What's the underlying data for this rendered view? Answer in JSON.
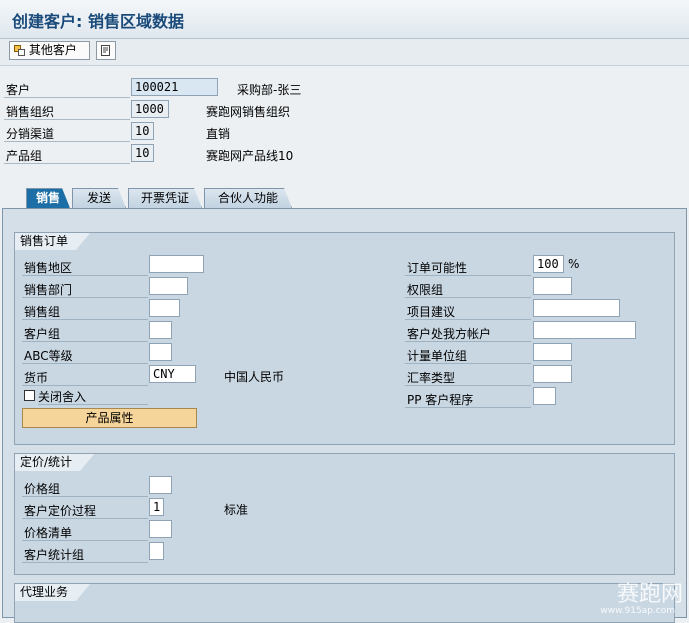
{
  "window": {
    "title": "创建客户: 销售区域数据"
  },
  "toolbar": {
    "other_customer_label": "其他客户"
  },
  "header": {
    "customer": {
      "label": "客户",
      "value": "100021",
      "desc": "采购部-张三"
    },
    "sales_org": {
      "label": "销售组织",
      "value": "1000",
      "desc": "赛跑网销售组织"
    },
    "dist_channel": {
      "label": "分销渠道",
      "value": "10",
      "desc": "直销"
    },
    "division": {
      "label": "产品组",
      "value": "10",
      "desc": "赛跑网产品线10"
    }
  },
  "tabs": [
    {
      "label": "销售",
      "active": true
    },
    {
      "label": "发送",
      "active": false
    },
    {
      "label": "开票凭证",
      "active": false
    },
    {
      "label": "合伙人功能",
      "active": false
    }
  ],
  "sales_order": {
    "title": "销售订单",
    "left": [
      {
        "label": "销售地区",
        "value": ""
      },
      {
        "label": "销售部门",
        "value": ""
      },
      {
        "label": "销售组",
        "value": ""
      },
      {
        "label": "客户组",
        "value": ""
      },
      {
        "label": "ABC等级",
        "value": ""
      },
      {
        "label": "货币",
        "value": "CNY",
        "desc": "中国人民币"
      }
    ],
    "right": [
      {
        "label": "订单可能性",
        "value": "100",
        "unit": "%"
      },
      {
        "label": "权限组",
        "value": ""
      },
      {
        "label": "项目建议",
        "value": ""
      },
      {
        "label": "客户处我方帐户",
        "value": ""
      },
      {
        "label": "计量单位组",
        "value": ""
      },
      {
        "label": "汇率类型",
        "value": ""
      },
      {
        "label": "PP 客户程序",
        "value": ""
      }
    ],
    "checkbox_label": "关闭舍入",
    "button_label": "产品属性"
  },
  "pricing": {
    "title": "定价/统计",
    "rows": [
      {
        "label": "价格组",
        "value": ""
      },
      {
        "label": "客户定价过程",
        "value": "1",
        "desc": "标准"
      },
      {
        "label": "价格清单",
        "value": ""
      },
      {
        "label": "客户统计组",
        "value": ""
      }
    ]
  },
  "agency": {
    "title": "代理业务"
  },
  "watermark": {
    "text": "赛跑网",
    "url": "www.915ap.com"
  }
}
